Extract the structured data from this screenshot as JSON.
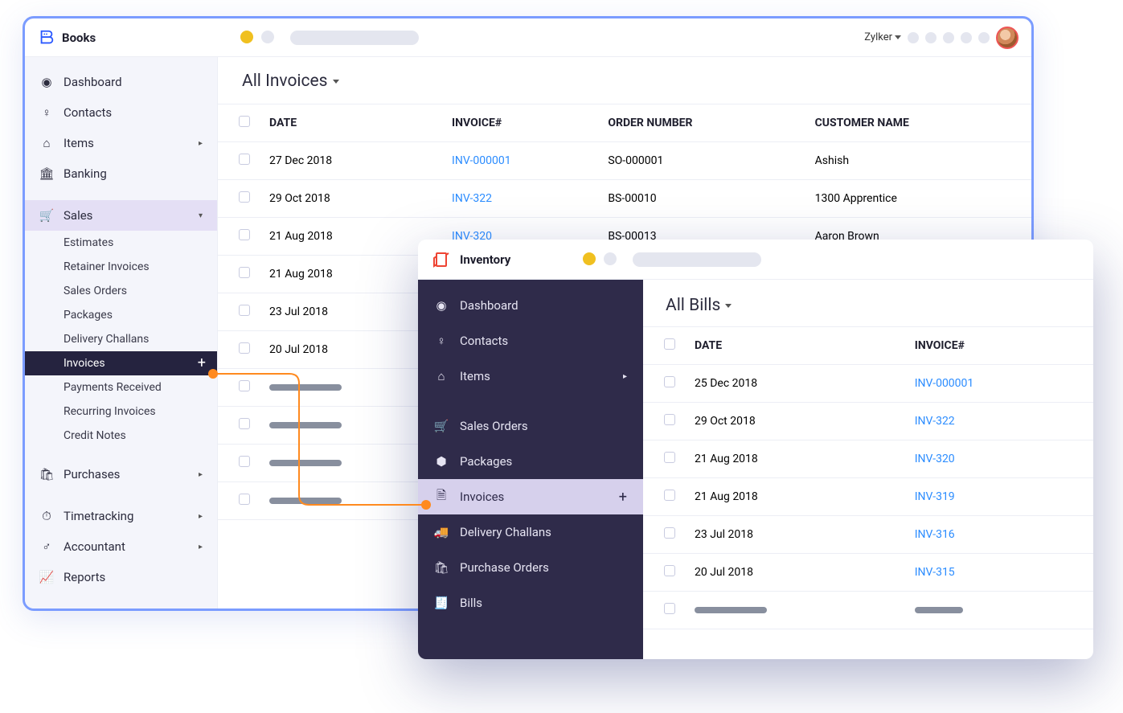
{
  "books": {
    "app_name": "Books",
    "org": "Zylker",
    "sidebar": {
      "dashboard": "Dashboard",
      "contacts": "Contacts",
      "items": "Items",
      "banking": "Banking",
      "sales": "Sales",
      "purchases": "Purchases",
      "timetracking": "Timetracking",
      "accountant": "Accountant",
      "reports": "Reports",
      "sub": {
        "estimates": "Estimates",
        "retainer": "Retainer Invoices",
        "salesorders": "Sales Orders",
        "packages": "Packages",
        "delivery": "Delivery Challans",
        "invoices": "Invoices",
        "payments": "Payments Received",
        "recurring": "Recurring Invoices",
        "credit": "Credit Notes"
      }
    },
    "page_title": "All Invoices",
    "columns": {
      "date": "DATE",
      "inv": "INVOICE#",
      "order": "ORDER NUMBER",
      "cust": "CUSTOMER NAME"
    },
    "rows": [
      {
        "date": "27 Dec 2018",
        "inv": "INV-000001",
        "order": "SO-000001",
        "cust": "Ashish"
      },
      {
        "date": "29 Oct 2018",
        "inv": "INV-322",
        "order": "BS-00010",
        "cust": "1300 Apprentice"
      },
      {
        "date": "21 Aug 2018",
        "inv": "INV-320",
        "order": "BS-00013",
        "cust": "Aaron Brown"
      },
      {
        "date": "21 Aug 2018",
        "inv": "",
        "order": "",
        "cust": ""
      },
      {
        "date": "23 Jul 2018",
        "inv": "",
        "order": "",
        "cust": ""
      },
      {
        "date": "20 Jul 2018",
        "inv": "",
        "order": "",
        "cust": ""
      }
    ]
  },
  "inventory": {
    "app_name": "Inventory",
    "sidebar": {
      "dashboard": "Dashboard",
      "contacts": "Contacts",
      "items": "Items",
      "salesorders": "Sales Orders",
      "packages": "Packages",
      "invoices": "Invoices",
      "delivery": "Delivery Challans",
      "purchaseorders": "Purchase Orders",
      "bills": "Bills"
    },
    "page_title": "All Bills",
    "columns": {
      "date": "DATE",
      "inv": "INVOICE#"
    },
    "rows": [
      {
        "date": "25 Dec 2018",
        "inv": "INV-000001"
      },
      {
        "date": "29 Oct 2018",
        "inv": "INV-322"
      },
      {
        "date": "21 Aug 2018",
        "inv": "INV-320"
      },
      {
        "date": "21 Aug 2018",
        "inv": "INV-319"
      },
      {
        "date": "23 Jul 2018",
        "inv": "INV-316"
      },
      {
        "date": "20 Jul 2018",
        "inv": "INV-315"
      }
    ]
  }
}
